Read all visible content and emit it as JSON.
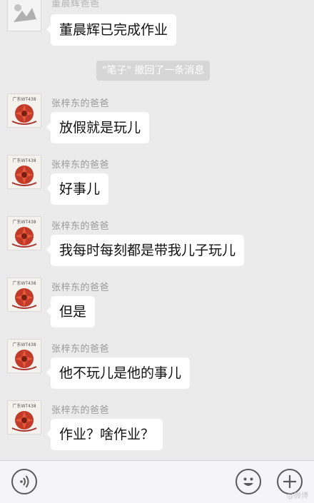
{
  "chat": {
    "top_partial": {
      "sender_partial": "董晨辉爸爸",
      "message": "董晨辉已完成作业"
    },
    "system_notice": "\"笔子\" 撤回了一条消息",
    "messages": [
      {
        "sender": "张梓东的爸爸",
        "avatar_caption": "广东WT438",
        "text": "放假就是玩儿"
      },
      {
        "sender": "张梓东的爸爸",
        "avatar_caption": "广东WT438",
        "text": "好事儿"
      },
      {
        "sender": "张梓东的爸爸",
        "avatar_caption": "广东WT438",
        "text": "我每时每刻都是带我儿子玩儿"
      },
      {
        "sender": "张梓东的爸爸",
        "avatar_caption": "广东WT438",
        "text": "但是"
      },
      {
        "sender": "张梓东的爸爸",
        "avatar_caption": "广东WT438",
        "text": "他不玩儿是他的事儿"
      },
      {
        "sender": "张梓东的爸爸",
        "avatar_caption": "广东WT438",
        "text": "作业？啥作业？"
      }
    ]
  },
  "toolbar": {
    "voice_icon": "voice-icon",
    "emoji_icon": "emoji-icon",
    "plus_icon": "plus-icon",
    "watermark": "@微博"
  },
  "colors": {
    "background": "#ebebeb",
    "bubble": "#ffffff",
    "system_notice_bg": "#d6d6d6",
    "sender_text": "#9a9a9a"
  }
}
